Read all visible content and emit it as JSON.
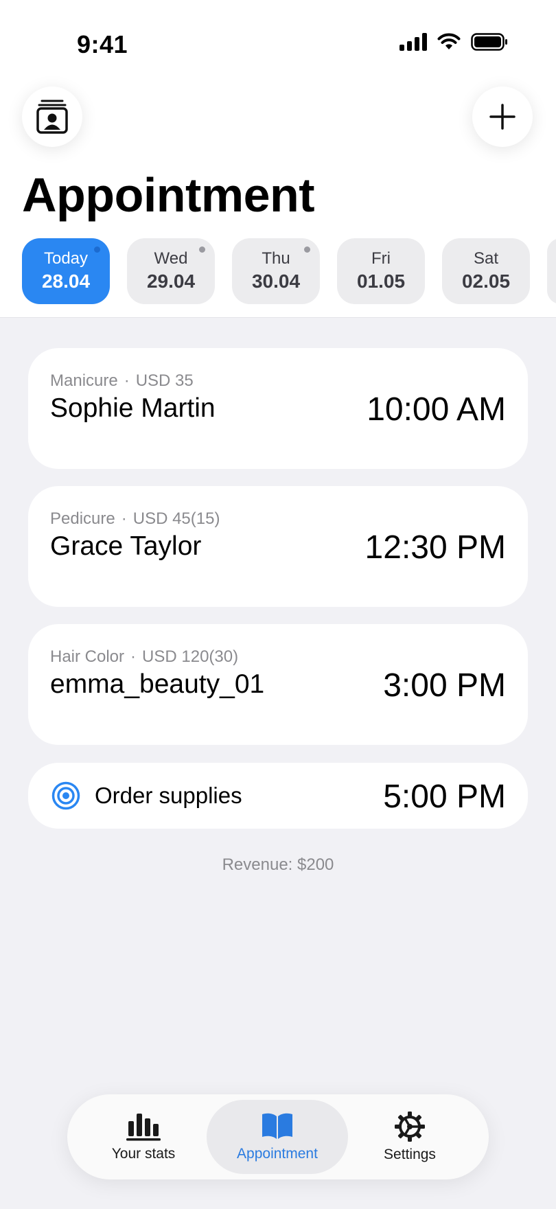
{
  "status": {
    "time": "9:41"
  },
  "header": {
    "title": "Appointment"
  },
  "dates": [
    {
      "day": "Today",
      "date": "28.04",
      "active": true,
      "has_dot": true
    },
    {
      "day": "Wed",
      "date": "29.04",
      "active": false,
      "has_dot": true
    },
    {
      "day": "Thu",
      "date": "30.04",
      "active": false,
      "has_dot": true
    },
    {
      "day": "Fri",
      "date": "01.05",
      "active": false,
      "has_dot": false
    },
    {
      "day": "Sat",
      "date": "02.05",
      "active": false,
      "has_dot": false
    }
  ],
  "appointments": [
    {
      "service": "Manicure",
      "price": "USD 35",
      "client": "Sophie Martin",
      "time": "10:00 AM"
    },
    {
      "service": "Pedicure",
      "price": "USD 45(15)",
      "client": "Grace Taylor",
      "time": "12:30 PM"
    },
    {
      "service": "Hair Color",
      "price": "USD 120(30)",
      "client": "emma_beauty_01",
      "time": "3:00 PM"
    }
  ],
  "task": {
    "label": "Order supplies",
    "time": "5:00 PM",
    "icon": "target-icon"
  },
  "revenue": "Revenue: $200",
  "tabbar": {
    "stats": "Your stats",
    "appointment": "Appointment",
    "settings": "Settings",
    "active": "appointment"
  },
  "colors": {
    "accent": "#2a87f2",
    "background": "#f1f1f5"
  }
}
